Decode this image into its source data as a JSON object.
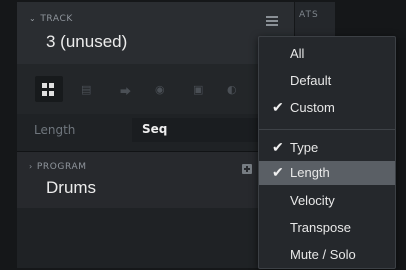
{
  "track": {
    "section_label": "TRACK",
    "name": "3 (unused)"
  },
  "right_strip": {
    "label": "ATS"
  },
  "length_row": {
    "label": "Length",
    "value": "Seq"
  },
  "program": {
    "section_label": "PROGRAM",
    "name": "Drums"
  },
  "menu": {
    "group1": [
      {
        "label": "All",
        "checked": false
      },
      {
        "label": "Default",
        "checked": false
      },
      {
        "label": "Custom",
        "checked": true
      }
    ],
    "group2": [
      {
        "label": "Type",
        "checked": true
      },
      {
        "label": "Length",
        "checked": true,
        "highlighted": true
      },
      {
        "label": "Velocity",
        "checked": false
      },
      {
        "label": "Transpose",
        "checked": false
      },
      {
        "label": "Mute / Solo",
        "checked": false
      }
    ]
  },
  "colors": {
    "panel": "#1f2225",
    "header": "#2a2d31",
    "menu_bg": "#25282c",
    "menu_highlight": "#5a5f65"
  }
}
